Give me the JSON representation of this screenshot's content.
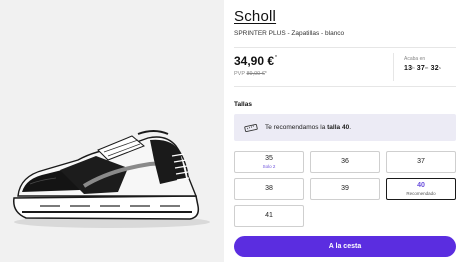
{
  "product": {
    "brand": "Scholl",
    "subtitle": "SPRINTER PLUS - Zapatillas - blanco",
    "image_alt": "Zapatilla deportiva blanca y negra"
  },
  "pricing": {
    "price": "34,90 €",
    "price_marker": "*",
    "pvp_label": "PVP",
    "pvp_old": "89,00 €",
    "pvp_marker": "*",
    "ends_label": "Acaba en",
    "countdown": {
      "h": "13",
      "h_unit": "h",
      "m": "37",
      "m_unit": "m",
      "s": "32",
      "s_unit": "s"
    }
  },
  "sizes": {
    "title": "Tallas",
    "recommend_prefix": "Te recomendamos la ",
    "recommend_size": "talla 40",
    "recommend_suffix": ".",
    "options": [
      {
        "label": "35",
        "note": "Solo 2"
      },
      {
        "label": "36",
        "note": ""
      },
      {
        "label": "37",
        "note": ""
      },
      {
        "label": "38",
        "note": ""
      },
      {
        "label": "39",
        "note": ""
      },
      {
        "label": "40",
        "note": "Recomendado",
        "selected": true
      },
      {
        "label": "41",
        "note": ""
      }
    ]
  },
  "cta": {
    "label": "A la cesta"
  },
  "colors": {
    "accent": "#5b2de0",
    "accent_text": "#6b4fdc",
    "recommend_bg": "#ecebf5"
  }
}
